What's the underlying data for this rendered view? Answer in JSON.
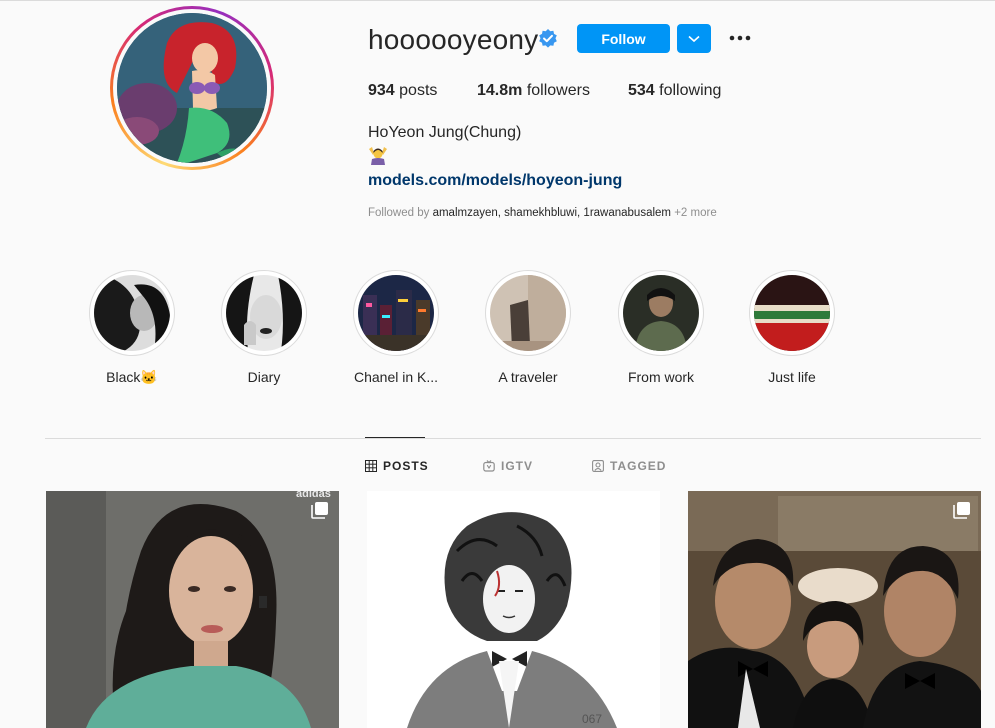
{
  "profile": {
    "username": "hoooooyeony",
    "follow_label": "Follow",
    "stats": {
      "posts_count": "934",
      "posts_label": "posts",
      "followers_count": "14.8m",
      "followers_label": "followers",
      "following_count": "534",
      "following_label": "following"
    },
    "full_name": "HoYeon Jung(Chung)",
    "website": "models.com/models/hoyeon-jung",
    "followed_by_prefix": "Followed by",
    "followed_by_names": "amalmzayen, shamekhbluwi, 1rawanabusalem",
    "followed_by_more": "+2 more"
  },
  "highlights": [
    {
      "label": "Black🐱"
    },
    {
      "label": "Diary"
    },
    {
      "label": "Chanel in K..."
    },
    {
      "label": "A traveler"
    },
    {
      "label": "From work"
    },
    {
      "label": "Just life"
    }
  ],
  "tabs": [
    {
      "label": "POSTS",
      "icon": "grid-icon",
      "active": true
    },
    {
      "label": "IGTV",
      "icon": "igtv-icon"
    },
    {
      "label": "TAGGED",
      "icon": "tagged-icon"
    }
  ],
  "posts": [
    {
      "brand": "adidas",
      "multi": true
    },
    {
      "number": "067",
      "multi": false
    },
    {
      "multi": true
    }
  ],
  "colors": {
    "accent": "#0095f6",
    "link": "#00376b",
    "text": "#262626",
    "muted": "#8e8e8e",
    "background": "#fafafa"
  }
}
